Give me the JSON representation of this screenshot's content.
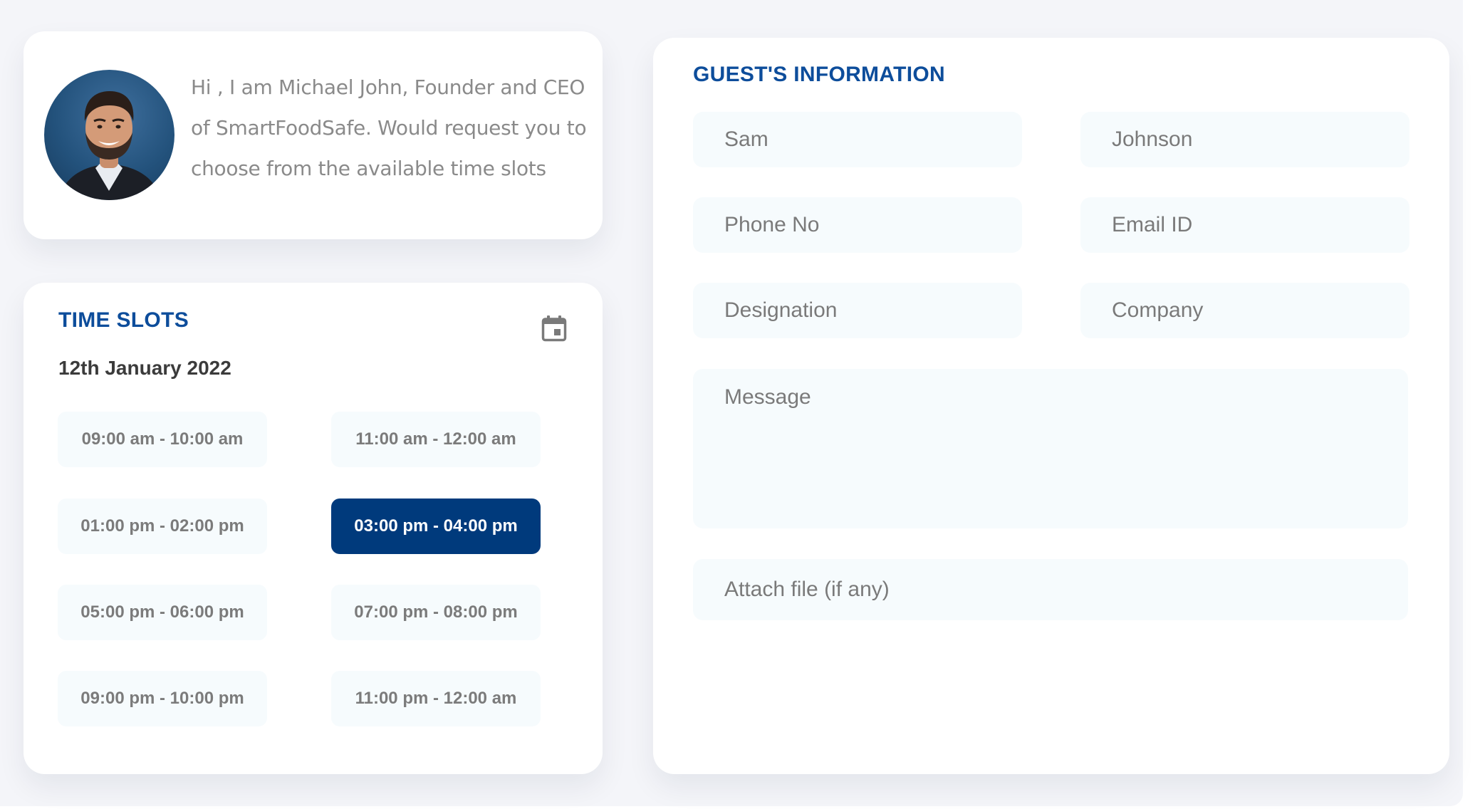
{
  "intro": {
    "message": "Hi , I am Michael John, Founder and CEO of SmartFoodSafe. Would request you to choose from the available time slots"
  },
  "time_slots": {
    "title": "TIME SLOTS",
    "date": "12th January 2022",
    "calendar_icon": "calendar-icon",
    "selected_index": 3,
    "slots": [
      "09:00 am - 10:00 am",
      "11:00 am - 12:00 am",
      "01:00 pm - 02:00 pm",
      "03:00 pm - 04:00 pm",
      "05:00 pm - 06:00 pm",
      "07:00 pm - 08:00 pm",
      "09:00 pm - 10:00 pm",
      "11:00 pm - 12:00 am"
    ]
  },
  "guest": {
    "title": "GUEST'S INFORMATION",
    "first_name": {
      "value": "",
      "placeholder": "Sam"
    },
    "last_name": {
      "value": "",
      "placeholder": "Johnson"
    },
    "phone": {
      "value": "",
      "placeholder": "Phone No"
    },
    "email": {
      "value": "",
      "placeholder": "Email ID"
    },
    "designation": {
      "value": "",
      "placeholder": "Designation"
    },
    "company": {
      "value": "",
      "placeholder": "Company"
    },
    "message": {
      "value": "",
      "placeholder": "Message"
    },
    "attach_label": "Attach file (if any)"
  },
  "colors": {
    "accent": "#0d4d9b",
    "selected_slot": "#003a7c",
    "field_bg": "#f6fbfd",
    "page_bg": "#f4f5f9"
  }
}
